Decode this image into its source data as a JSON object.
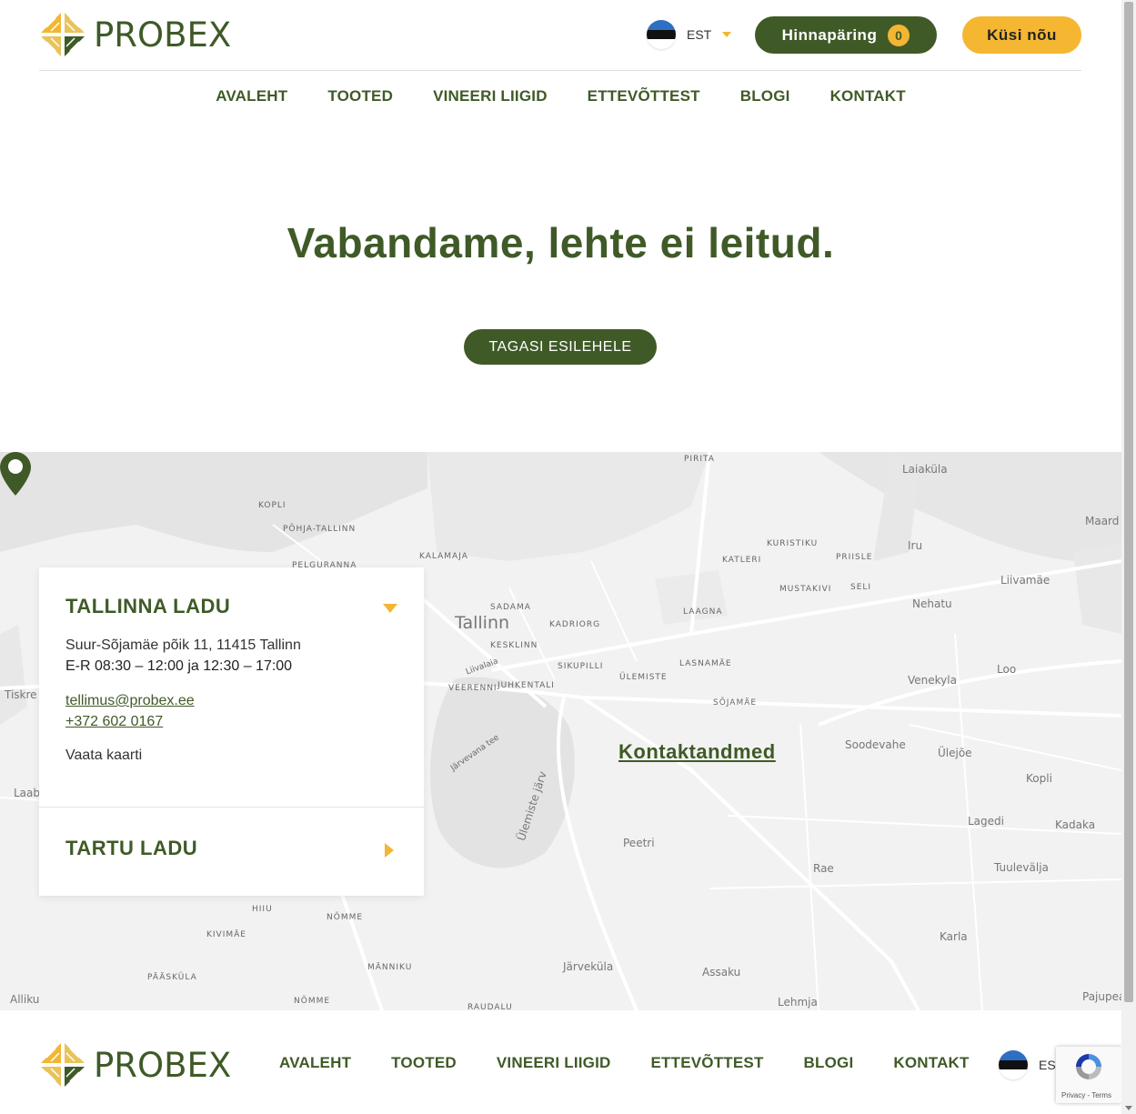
{
  "brand": {
    "name": "PROBEX",
    "colors": {
      "green": "#3f5a27",
      "yellow": "#f2b632"
    }
  },
  "header": {
    "language": "EST",
    "quote_label": "Hinnapäring",
    "quote_count": "0",
    "ask_label": "Küsi nõu"
  },
  "nav": [
    "AVALEHT",
    "TOOTED",
    "VINEERI LIIGID",
    "ETTEVÕTTEST",
    "BLOGI",
    "KONTAKT"
  ],
  "main": {
    "heading": "Vabandame, lehte ei leitud.",
    "back_button": "TAGASI ESILEHELE"
  },
  "map": {
    "contact_link": "Kontaktandmed",
    "labels": {
      "pirita": "PIRITA",
      "laiakyla": "Laiaküla",
      "maardu": "Maard",
      "kopli": "KOPLI",
      "pohja": "PÕHJA-TALLINN",
      "kalamaja": "KALAMAJA",
      "pelguranna": "PELGURANNA",
      "kuristiku": "KURISTIKU",
      "priisle": "PRIISLE",
      "iru": "Iru",
      "katleri": "KATLERI",
      "liivamae": "Liivamäe",
      "mustakivi": "MUSTAKIVI",
      "seli": "SELI",
      "nehatu": "Nehatu",
      "sadama": "SADAMA",
      "tallinn": "Tallinn",
      "kadriorg": "KADRIORG",
      "laagna": "LAAGNA",
      "kesklinn": "KESKLINN",
      "sikupilli": "SIKUPILLI",
      "lasnamae": "LASNAMÄE",
      "ulemiste": "ÜLEMISTE",
      "veerenni": "VEERENNI",
      "juhkentali": "JUHKENTALI",
      "sojamae": "SÕJAMÄE",
      "venekyla": "Venekyla",
      "loo": "Loo",
      "tiskre": "Tiskre",
      "soodevahe": "Soodevahe",
      "ulejoe": "Ülejõe",
      "kopli2": "Kopli",
      "lagedi": "Lagedi",
      "kadaka": "Kadaka",
      "peetri": "Peetri",
      "rae": "Rae",
      "tuulevalja": "Tuulevälja",
      "karla": "Karla",
      "hiiu": "HIIU",
      "nomme": "NÕMME",
      "kivimae": "KIVIMÄE",
      "manniku": "MÄNNIKU",
      "jarvekyla": "Järveküla",
      "assaku": "Assaku",
      "paaskyla": "PÄÄSKÜLA",
      "alliku": "Alliku",
      "nomme2": "NÕMME",
      "raudalu": "RAUDALU",
      "lehmja": "Lehmja",
      "pajupea": "Pajupea",
      "laab": "Laab",
      "jarvevana": "Järvevana tee",
      "ulemistejarv": "Ülemiste järv",
      "liivalaia": "Liivalaia"
    }
  },
  "card": {
    "tallinn_title": "TALLINNA LADU",
    "address": "Suur-Sõjamäe põik 11, 11415 Tallinn",
    "hours": "E-R 08:30 – 12:00 ja 12:30 – 17:00",
    "email": "tellimus@probex.ee",
    "phone": "+372 602 0167",
    "map_link": "Vaata kaarti",
    "tartu_title": "TARTU LADU"
  },
  "recaptcha": {
    "text": "Privacy - Terms"
  }
}
